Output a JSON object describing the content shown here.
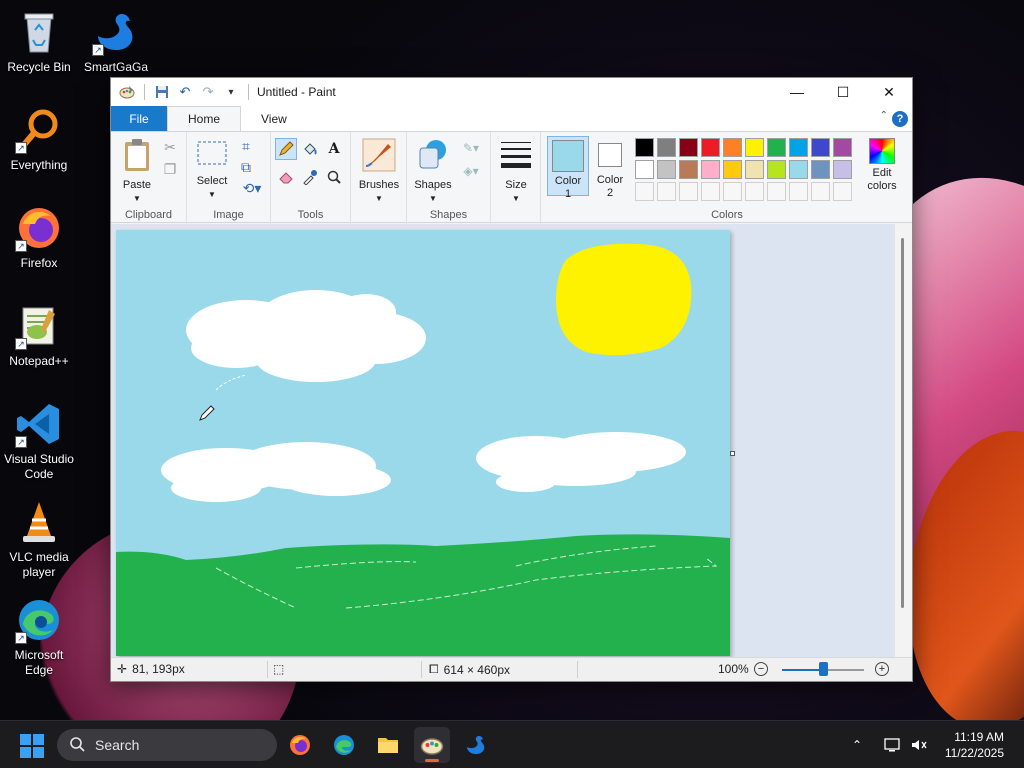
{
  "desktop": {
    "icons": [
      {
        "label": "Recycle Bin"
      },
      {
        "label": "SmartGaGa"
      },
      {
        "label": "Everything"
      },
      {
        "label": "Firefox"
      },
      {
        "label": "Notepad++"
      },
      {
        "label": "Visual Studio Code"
      },
      {
        "label": "VLC media player"
      },
      {
        "label": "Microsoft Edge"
      }
    ]
  },
  "window": {
    "title": "Untitled - Paint",
    "tabs": [
      "File",
      "Home",
      "View"
    ],
    "ribbon": {
      "clipboard": {
        "label": "Clipboard",
        "paste": "Paste"
      },
      "image": {
        "label": "Image",
        "select": "Select"
      },
      "tools": {
        "label": "Tools"
      },
      "brushes": {
        "label": "Brushes"
      },
      "shapes": {
        "label": "Shapes",
        "button": "Shapes"
      },
      "size": {
        "label": "Size"
      },
      "colors": {
        "label": "Colors",
        "color1_line1": "Color",
        "color1_line2": "1",
        "color2_line1": "Color",
        "color2_line2": "2",
        "edit_line1": "Edit",
        "edit_line2": "colors",
        "color1_value": "#99d9ea",
        "color2_value": "#ffffff",
        "palette_row1": [
          "#000000",
          "#7f7f7f",
          "#880015",
          "#ed1c24",
          "#ff7f27",
          "#fff200",
          "#22b14c",
          "#00a2e8",
          "#3f48cc",
          "#a349a4"
        ],
        "palette_row2": [
          "#ffffff",
          "#c3c3c3",
          "#b97a57",
          "#ffaec9",
          "#ffc90e",
          "#efe4b0",
          "#b5e61d",
          "#99d9ea",
          "#7092be",
          "#c8bfe7"
        ]
      }
    },
    "status": {
      "cursor_pos": "81, 193px",
      "canvas_size": "614 × 460px",
      "zoom": "100%",
      "zoom_slider_percent": 50
    }
  },
  "taskbar": {
    "search_placeholder": "Search",
    "time": "11:19 AM",
    "date": "11/22/2025"
  }
}
